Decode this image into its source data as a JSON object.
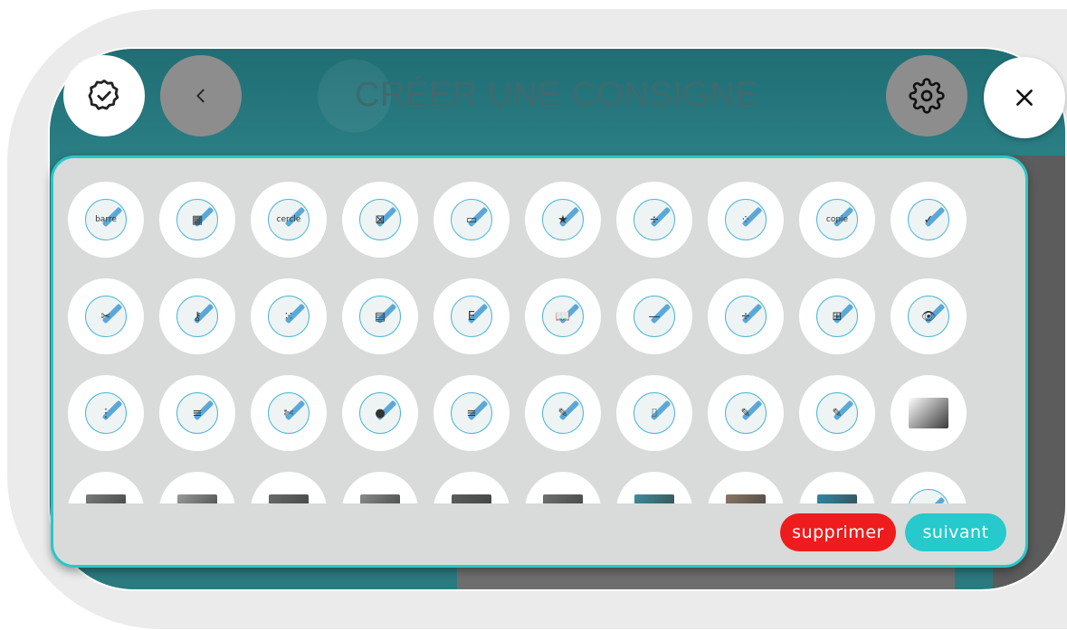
{
  "header": {
    "title": "CRÉER UNE CONSIGNE"
  },
  "colors": {
    "accent": "#26c9cc",
    "delete": "#ee1c1c",
    "header": "#1f6e74",
    "panel": "#d8dbd9"
  },
  "icons": {
    "validate": "badge-check-icon",
    "back": "chevron-left-icon",
    "settings": "gear-icon",
    "close": "close-icon"
  },
  "tiles": [
    {
      "icon": "barre-icon",
      "glyph": "barre"
    },
    {
      "icon": "calculator-icon",
      "glyph": "▦"
    },
    {
      "icon": "cercle-loupe-icon",
      "glyph": "cercle"
    },
    {
      "icon": "triangle-pencil-icon",
      "glyph": "⊠"
    },
    {
      "icon": "eraser-pencil-icon",
      "glyph": "▭"
    },
    {
      "icon": "star-pencil-icon",
      "glyph": "★"
    },
    {
      "icon": "multiplier-icon",
      "glyph": "÷"
    },
    {
      "icon": "dots-grid-icon",
      "glyph": "⁘"
    },
    {
      "icon": "copie-icon",
      "glyph": "copie"
    },
    {
      "icon": "liste-check-icon",
      "glyph": "✓"
    },
    {
      "icon": "scissors-icon",
      "glyph": "✂"
    },
    {
      "icon": "keys-compass-icon",
      "glyph": "⚷"
    },
    {
      "icon": "mosaic-eraser-icon",
      "glyph": "⁙"
    },
    {
      "icon": "grid-pencil-icon",
      "glyph": "▤"
    },
    {
      "icon": "letter-e-icon",
      "glyph": "E"
    },
    {
      "icon": "book-icon",
      "glyph": "📖"
    },
    {
      "icon": "ruler-pencil-icon",
      "glyph": "—"
    },
    {
      "icon": "division-pencil-icon",
      "glyph": "÷"
    },
    {
      "icon": "fraction-table-icon",
      "glyph": "⊞"
    },
    {
      "icon": "eye-icon",
      "glyph": "👁"
    },
    {
      "icon": "points-ruler-icon",
      "glyph": "⋮"
    },
    {
      "icon": "text-marker-icon",
      "glyph": "≡"
    },
    {
      "icon": "cut-shape-icon",
      "glyph": "✄"
    },
    {
      "icon": "brain-icon",
      "glyph": "●"
    },
    {
      "icon": "souligner-icon",
      "glyph": "≡"
    },
    {
      "icon": "surligner-icon",
      "glyph": "✎"
    },
    {
      "icon": "depuis-icon",
      "glyph": "⌷"
    },
    {
      "icon": "ruler-draw-icon",
      "glyph": "✎"
    },
    {
      "icon": "ecrire-icon",
      "glyph": "✎"
    },
    {
      "icon": "photo-person-icon",
      "glyph": "photo"
    },
    {
      "icon": "photo-icon",
      "glyph": "photo"
    },
    {
      "icon": "photo-icon",
      "glyph": "photo"
    },
    {
      "icon": "photo-icon",
      "glyph": "photo"
    },
    {
      "icon": "photo-icon",
      "glyph": "photo"
    },
    {
      "icon": "photo-icon",
      "glyph": "photo"
    },
    {
      "icon": "photo-icon",
      "glyph": "photo"
    },
    {
      "icon": "photo-icon",
      "glyph": "photo"
    },
    {
      "icon": "photo-icon",
      "glyph": "photo"
    },
    {
      "icon": "photo-icon",
      "glyph": "photo"
    },
    {
      "icon": "marker-red-icon",
      "glyph": "▮"
    }
  ],
  "actions": {
    "delete_label": "supprimer",
    "next_label": "suivant"
  }
}
